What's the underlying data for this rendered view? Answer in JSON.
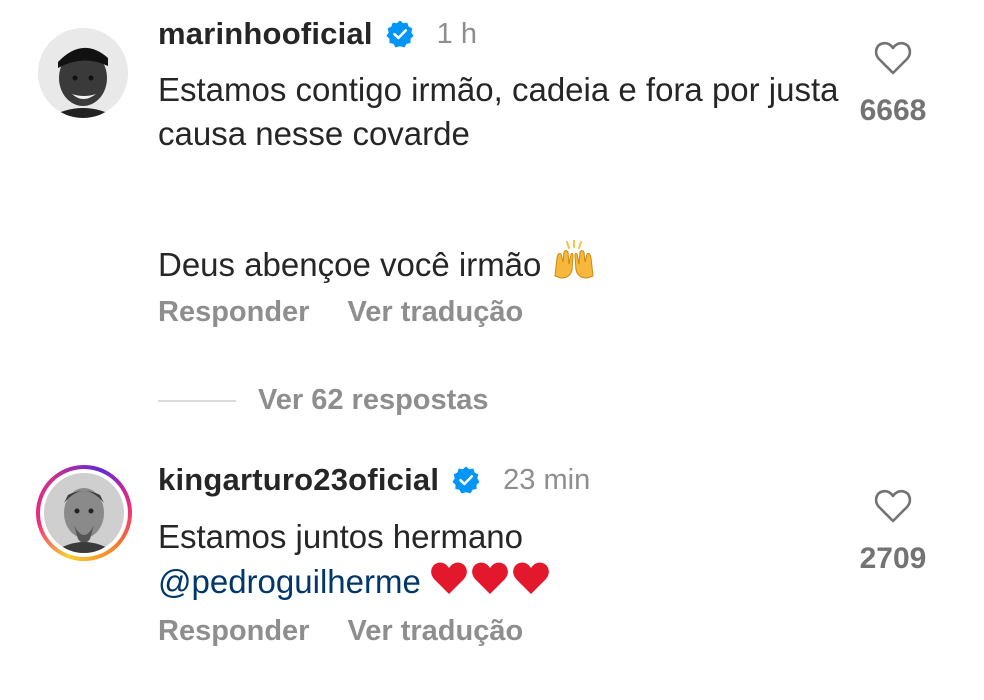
{
  "comments": [
    {
      "username": "marinhooficial",
      "time": "1 h",
      "text_line1": "Estamos contigo irmão, cadeia e fora por justa causa nesse covarde",
      "text_line2": "Deus abençoe você irmão",
      "emoji": "raising-hands",
      "reply_label": "Responder",
      "translate_label": "Ver tradução",
      "like_count": "6668"
    },
    {
      "username": "kingarturo23oficial",
      "time": "23 min",
      "text": "Estamos juntos hermano",
      "mention": "@pedroguilherme",
      "emoji": "red-hearts",
      "reply_label": "Responder",
      "translate_label": "Ver tradução",
      "like_count": "2709"
    }
  ],
  "view_replies_label": "Ver 62 respostas",
  "colors": {
    "verified": "#0095f6",
    "mention": "#00376b",
    "secondary_text": "#8e8e8e"
  }
}
